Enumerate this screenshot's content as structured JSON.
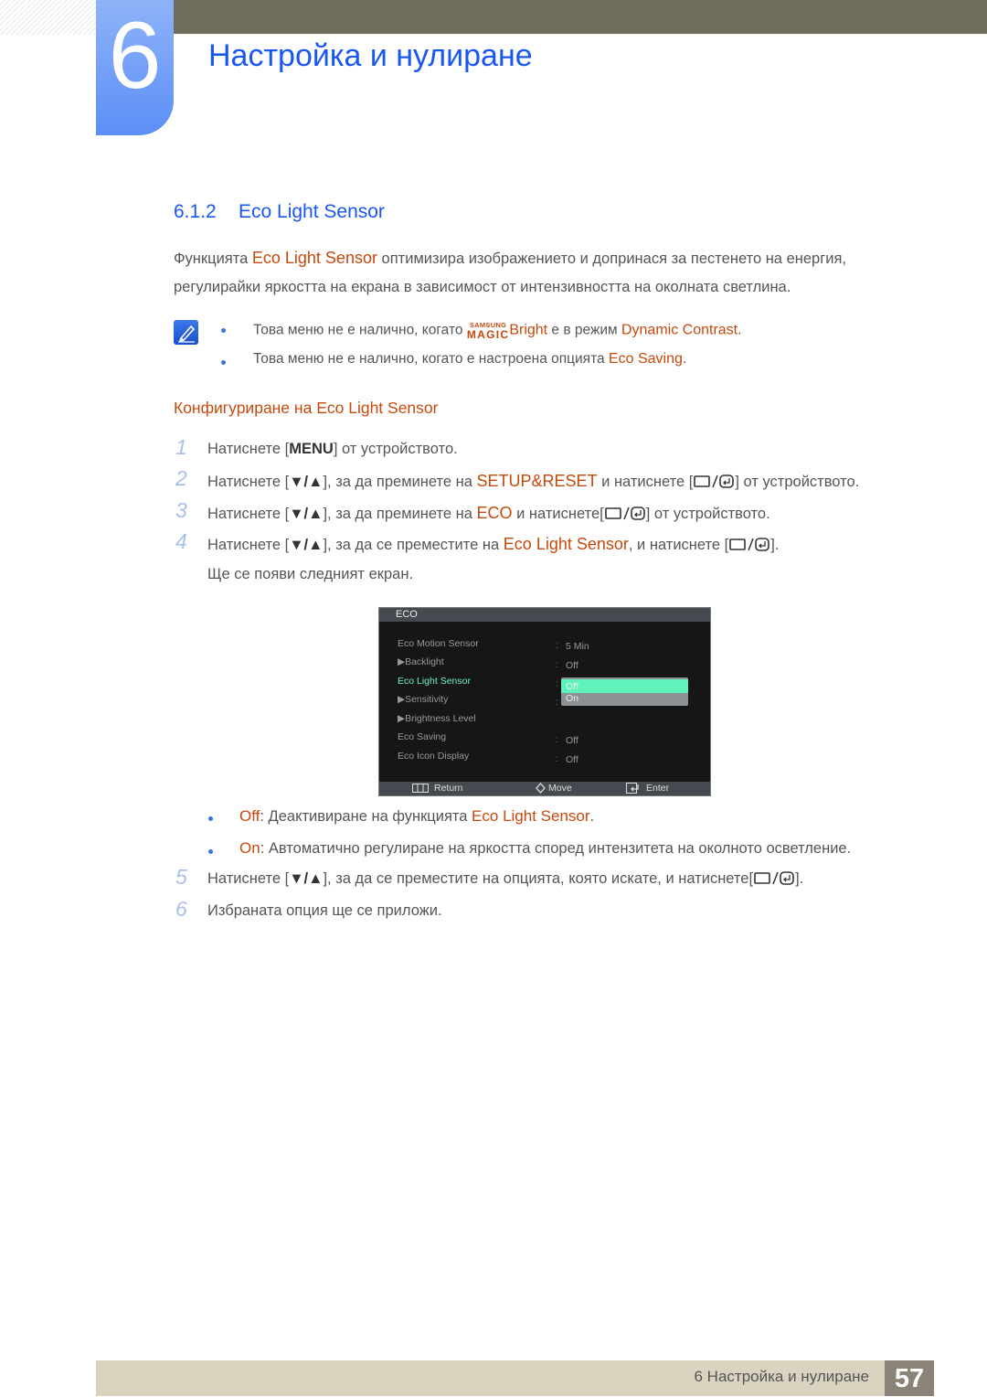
{
  "header": {
    "chapter_number": "6",
    "chapter_title": "Настройка и нулиране"
  },
  "section": {
    "number": "6.1.2",
    "title": "Eco Light Sensor"
  },
  "intro": {
    "prefix": "Функцията ",
    "highlight": "Eco Light Sensor",
    "line1_rest": " оптимизира изображението и допринася за пестенето на енергия,",
    "line2": "регулирайки яркостта на екрана в зависимост от интензивността на околната светлина."
  },
  "notes": {
    "icon": "note-pencil-icon",
    "items": [
      {
        "before": "Това меню не е налично, когато ",
        "magic_top": "SAMSUNG",
        "magic_bottom": "MAGIC",
        "magic_word": "Bright",
        "middle": " е в режим ",
        "highlight": "Dynamic Contrast",
        "after": "."
      },
      {
        "before": "Това меню не е налично, когато е настроена опцията ",
        "highlight": "Eco Saving",
        "after": "."
      }
    ]
  },
  "subheading": "Конфигуриране на Eco Light Sensor",
  "steps": [
    {
      "num": "1",
      "a": "Натиснете [",
      "key": "MENU",
      "b": "] от устройството."
    },
    {
      "num": "2",
      "a": "Натиснете [",
      "arrows": "▼/▲",
      "b": "], за да преминете на ",
      "hl": "SETUP&RESET",
      "c": " и натиснете [",
      "d": "] от устройството."
    },
    {
      "num": "3",
      "a": "Натиснете [",
      "arrows": "▼/▲",
      "b": "], за да преминете на ",
      "hl": "ECO",
      "c": " и натиснете[",
      "d": "] от устройството."
    },
    {
      "num": "4",
      "a": "Натиснете [",
      "arrows": "▼/▲",
      "b": "], за да се преместите на ",
      "hl": "Eco Light Sensor",
      "c": ", и натиснете [",
      "d": "]."
    },
    {
      "num": "5",
      "a": "Натиснете [",
      "arrows": "▼/▲",
      "b": "], за да се преместите на опцията, която искате, и натиснете[",
      "d": "]."
    },
    {
      "num": "6",
      "a": "Избраната опция ще се приложи."
    }
  ],
  "step4_note": "Ще се появи следният екран.",
  "osd": {
    "title": "ECO",
    "items": [
      {
        "label": "Eco Motion Sensor",
        "value": "5 Min",
        "arrow": false,
        "selected": false
      },
      {
        "label": "Backlight",
        "value": "Off",
        "arrow": true,
        "selected": false
      },
      {
        "label": "Eco Light Sensor",
        "value": "",
        "arrow": false,
        "selected": true
      },
      {
        "label": "Sensitivity",
        "value": "",
        "arrow": true,
        "selected": false
      },
      {
        "label": "Brightness Level",
        "value": "",
        "arrow": true,
        "selected": false
      },
      {
        "label": "Eco Saving",
        "value": "Off",
        "arrow": false,
        "selected": false
      },
      {
        "label": "Eco Icon Display",
        "value": "Off",
        "arrow": false,
        "selected": false
      }
    ],
    "dropdown": {
      "options": [
        "Off",
        "On"
      ],
      "highlighted": "Off"
    },
    "footer": {
      "return": "Return",
      "move": "Move",
      "enter": "Enter"
    }
  },
  "options": [
    {
      "label": "Off",
      "text": ": Деактивиране на функцията ",
      "hl": "Eco Light Sensor",
      "after": "."
    },
    {
      "label": "On",
      "text": ": Автоматично регулиране на яркостта според интензитета на околното осветление.",
      "hl": "",
      "after": ""
    }
  ],
  "footer": {
    "text": "6 Настройка и нулиране",
    "page": "57"
  }
}
